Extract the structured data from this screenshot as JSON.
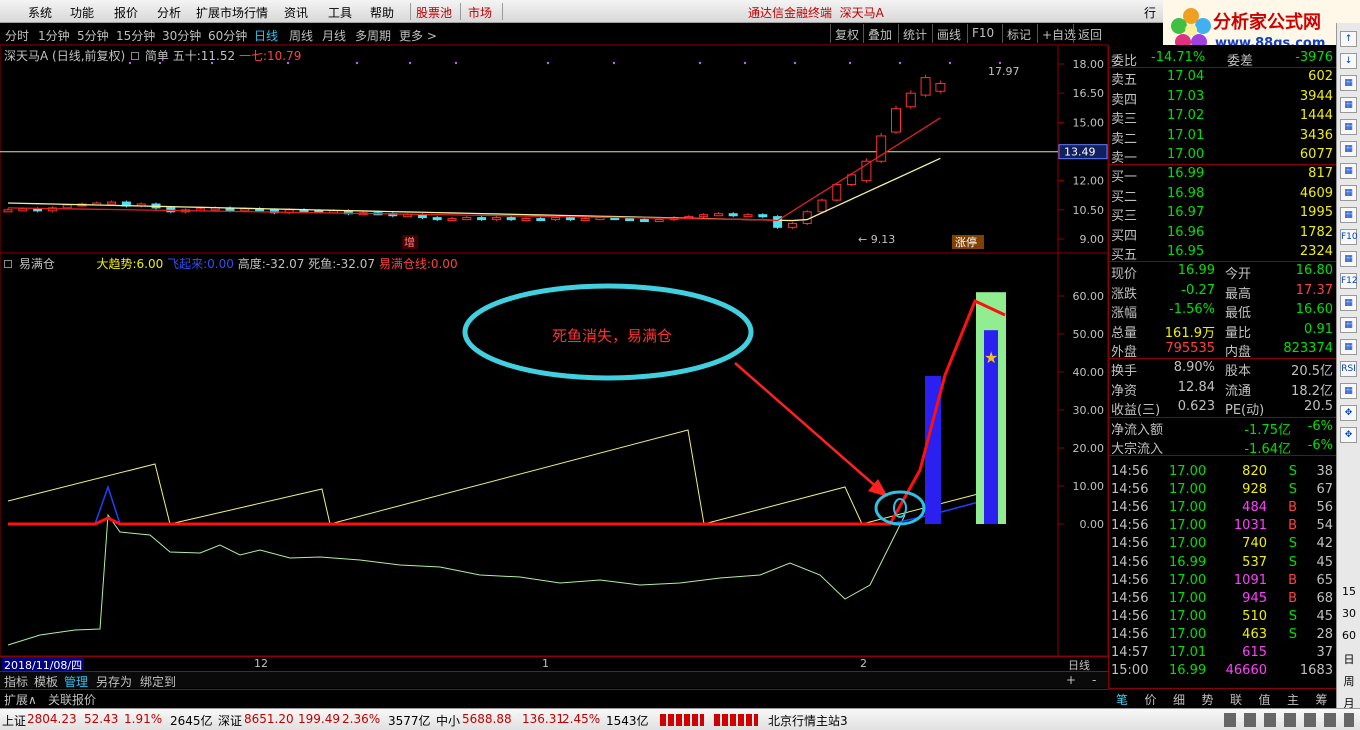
{
  "menubar": {
    "items": [
      "系统",
      "功能",
      "报价",
      "分析",
      "扩展市场行情",
      "资讯",
      "工具",
      "帮助"
    ],
    "stock_pool": "股票池",
    "market": "市场",
    "app_title": "通达信金融终端",
    "stock_title": "深天马A",
    "right_btn": "行"
  },
  "logo": {
    "text1": "分析家公式网",
    "text2": "www.88gs.com"
  },
  "toolbar": {
    "periods": [
      "分时",
      "1分钟",
      "5分钟",
      "15分钟",
      "30分钟",
      "60分钟",
      "日线",
      "周线",
      "月线",
      "多周期",
      "更多 >"
    ],
    "active_index": 6,
    "buttons": [
      "复权",
      "叠加",
      "统计",
      "画线",
      "F10",
      "标记",
      "+自选",
      "返回"
    ]
  },
  "main_info": {
    "stock": "深天马A",
    "mode": "(日线,前复权)",
    "indicator": "简单",
    "ma50_label": "五十:",
    "ma50_value": "11.52",
    "ma17_label": "一七:",
    "ma17_value": "10.79"
  },
  "sub_info": {
    "indicator": "易满仓",
    "trend_label": "大趋势:",
    "trend_value": "6.00",
    "rise_label": "飞起来:",
    "rise_value": "0.00",
    "height_label": "高度:",
    "height_value": "-32.07",
    "dead_label": "死鱼:",
    "dead_value": "-32.07",
    "line_label": "易满仓线:",
    "line_value": "0.00"
  },
  "price_axis": [
    "18.00",
    "16.50",
    "15.00",
    "13.50",
    "12.00",
    "10.50",
    "9.00"
  ],
  "price_tag": "13.49",
  "sub_axis": [
    "60.00",
    "50.00",
    "40.00",
    "30.00",
    "20.00",
    "10.00",
    "0.00"
  ],
  "chart_labels": {
    "high": "17.97",
    "low": "9.13",
    "zeng": "增",
    "zhangting": "涨停"
  },
  "annotation": "死鱼消失，易满仓",
  "datebar": {
    "start": "2018/11/08/四",
    "marks": [
      "12",
      "1",
      "2"
    ],
    "period": "日线"
  },
  "tabsbar": {
    "items": [
      "指标",
      "模板",
      "管理",
      "另存为",
      "绑定到"
    ],
    "active_index": 2,
    "plus": "+",
    "minus": "-"
  },
  "bottomtabs": {
    "items": [
      "扩展∧",
      "关联报价"
    ]
  },
  "status": {
    "sh_label": "上证",
    "sh_value": "2804.23",
    "sh_change": "52.43",
    "sh_pct": "1.91%",
    "sh_amt": "2645亿",
    "sz_label": "深证",
    "sz_value": "8651.20",
    "sz_change": "199.49",
    "sz_pct": "2.36%",
    "sz_amt": "3577亿",
    "zx_label": "中小",
    "zx_value": "5688.88",
    "zx_change": "136.31",
    "zx_pct": "2.45%",
    "zx_amt": "1543亿",
    "server": "北京行情主站3"
  },
  "quote": {
    "weibi_label": "委比",
    "weibi": "-14.71%",
    "weicha_label": "委差",
    "weicha": "-3976",
    "asks": [
      {
        "label": "卖五",
        "price": "17.04",
        "vol": "602"
      },
      {
        "label": "卖四",
        "price": "17.03",
        "vol": "3944"
      },
      {
        "label": "卖三",
        "price": "17.02",
        "vol": "1444"
      },
      {
        "label": "卖二",
        "price": "17.01",
        "vol": "3436"
      },
      {
        "label": "卖一",
        "price": "17.00",
        "vol": "6077"
      }
    ],
    "bids": [
      {
        "label": "买一",
        "price": "16.99",
        "vol": "817"
      },
      {
        "label": "买二",
        "price": "16.98",
        "vol": "4609"
      },
      {
        "label": "买三",
        "price": "16.97",
        "vol": "1995"
      },
      {
        "label": "买四",
        "price": "16.96",
        "vol": "1782"
      },
      {
        "label": "买五",
        "price": "16.95",
        "vol": "2324"
      }
    ],
    "stats": [
      {
        "l1": "现价",
        "v1": "16.99",
        "c1": "g",
        "l2": "今开",
        "v2": "16.80",
        "c2": "g"
      },
      {
        "l1": "涨跌",
        "v1": "-0.27",
        "c1": "g",
        "l2": "最高",
        "v2": "17.37",
        "c2": "rd"
      },
      {
        "l1": "涨幅",
        "v1": "-1.56%",
        "c1": "g",
        "l2": "最低",
        "v2": "16.60",
        "c2": "g"
      },
      {
        "l1": "总量",
        "v1": "161.9万",
        "c1": "y",
        "l2": "量比",
        "v2": "0.91",
        "c2": "g"
      },
      {
        "l1": "外盘",
        "v1": "795535",
        "c1": "rd",
        "l2": "内盘",
        "v2": "823374",
        "c2": "g"
      }
    ],
    "stats2": [
      {
        "l1": "换手",
        "v1": "8.90%",
        "l2": "股本",
        "v2": "20.5亿"
      },
      {
        "l1": "净资",
        "v1": "12.84",
        "l2": "流通",
        "v2": "18.2亿"
      },
      {
        "l1": "收益(三)",
        "v1": "0.623",
        "l2": "PE(动)",
        "v2": "20.5"
      }
    ],
    "flows": [
      {
        "label": "净流入额",
        "v1": "-1.75亿",
        "v2": "-6%"
      },
      {
        "label": "大宗流入",
        "v1": "-1.64亿",
        "v2": "-6%"
      }
    ],
    "ticks": [
      {
        "t": "14:56",
        "p": "17.00",
        "v": "820",
        "bs": "S",
        "n": "38"
      },
      {
        "t": "14:56",
        "p": "17.00",
        "v": "928",
        "bs": "S",
        "n": "67"
      },
      {
        "t": "14:56",
        "p": "17.00",
        "v": "484",
        "bs": "B",
        "n": "56"
      },
      {
        "t": "14:56",
        "p": "17.00",
        "v": "1031",
        "bs": "B",
        "n": "54"
      },
      {
        "t": "14:56",
        "p": "17.00",
        "v": "740",
        "bs": "S",
        "n": "42"
      },
      {
        "t": "14:56",
        "p": "16.99",
        "v": "537",
        "bs": "S",
        "n": "45"
      },
      {
        "t": "14:56",
        "p": "17.00",
        "v": "1091",
        "bs": "B",
        "n": "65"
      },
      {
        "t": "14:56",
        "p": "17.00",
        "v": "945",
        "bs": "B",
        "n": "68"
      },
      {
        "t": "14:56",
        "p": "17.00",
        "v": "510",
        "bs": "S",
        "n": "45"
      },
      {
        "t": "14:56",
        "p": "17.00",
        "v": "463",
        "bs": "S",
        "n": "28"
      },
      {
        "t": "14:57",
        "p": "17.01",
        "v": "615",
        "bs": "",
        "n": "37"
      },
      {
        "t": "15:00",
        "p": "16.99",
        "v": "46660",
        "bs": "",
        "n": "1683"
      }
    ]
  },
  "rtabs": [
    "笔",
    "价",
    "细",
    "势",
    "联",
    "值",
    "主",
    "筹"
  ],
  "sidebar": {
    "buttons": [
      "↑",
      "↓",
      "▦",
      "▦",
      "▦",
      "▦",
      "▦",
      "▦",
      "▦",
      "F10",
      "▦",
      "F12",
      "▦",
      "▦",
      "▦",
      "RSI",
      "▦",
      "✥",
      "✥"
    ],
    "texts": [
      "15",
      "30",
      "60",
      "日",
      "周",
      "月"
    ]
  }
}
